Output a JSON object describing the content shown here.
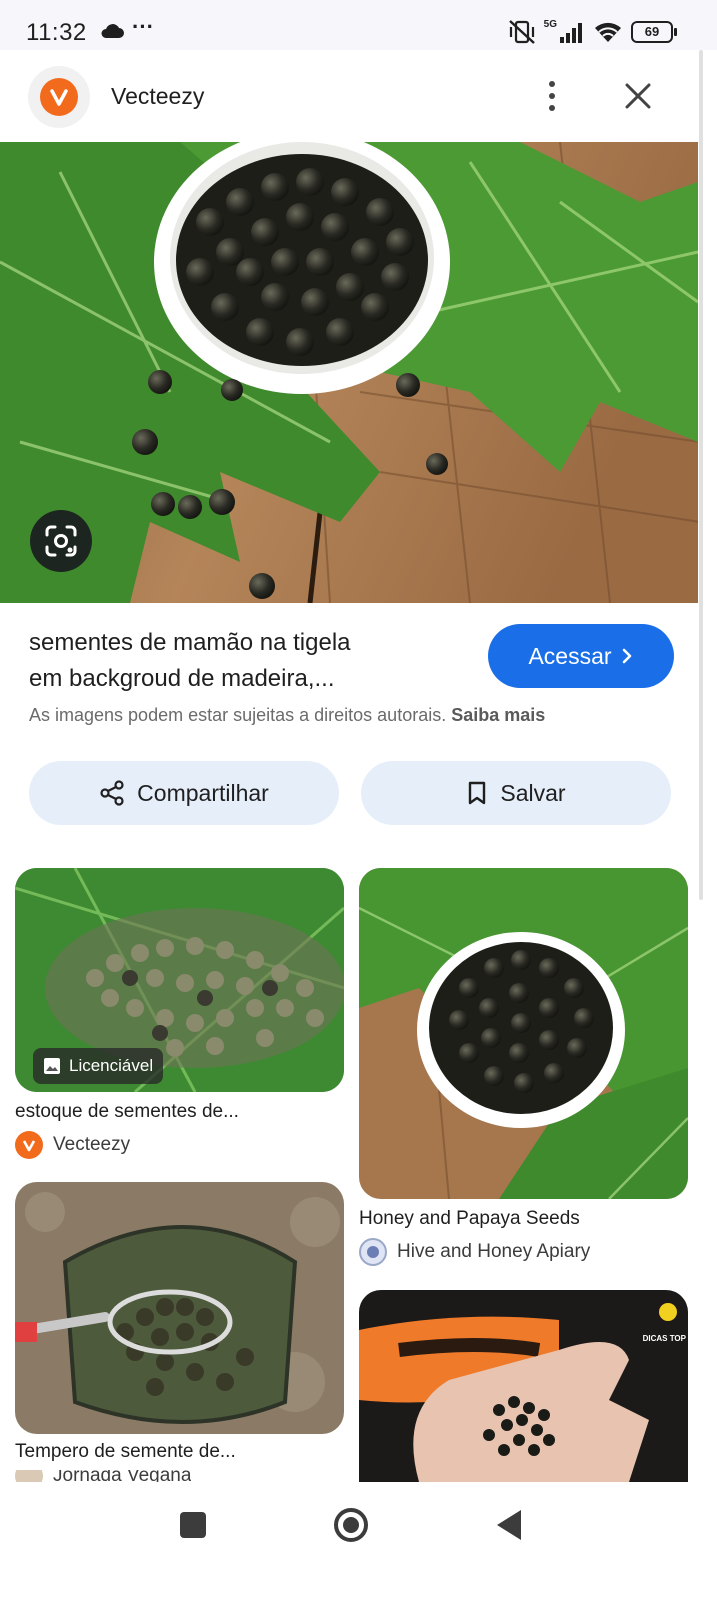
{
  "status_bar": {
    "time": "11:32",
    "network": "5G",
    "battery": "69"
  },
  "header": {
    "site_name": "Vecteezy",
    "logo_letter": "v"
  },
  "result": {
    "title_line1": "sementes de mamão na tigela",
    "title_line2": "em backgroud de madeira,...",
    "access_label": "Acessar",
    "copyright_text": "As imagens podem estar sujeitas a direitos autorais.",
    "learn_more": "Saiba mais"
  },
  "actions": {
    "share_label": "Compartilhar",
    "save_label": "Salvar"
  },
  "related": [
    {
      "caption": "estoque de sementes de...",
      "source": "Vecteezy",
      "badge": "Licenciável"
    },
    {
      "caption": "Honey and Papaya Seeds",
      "source": "Hive and Honey Apiary"
    },
    {
      "caption": "Tempero de semente de...",
      "source": "Jornada Vegana"
    },
    {
      "watermark": "DICAS TOP"
    }
  ],
  "colors": {
    "accent": "#1a6fe8",
    "brand": "#f26b1d",
    "chip_bg": "#e6eef9"
  }
}
